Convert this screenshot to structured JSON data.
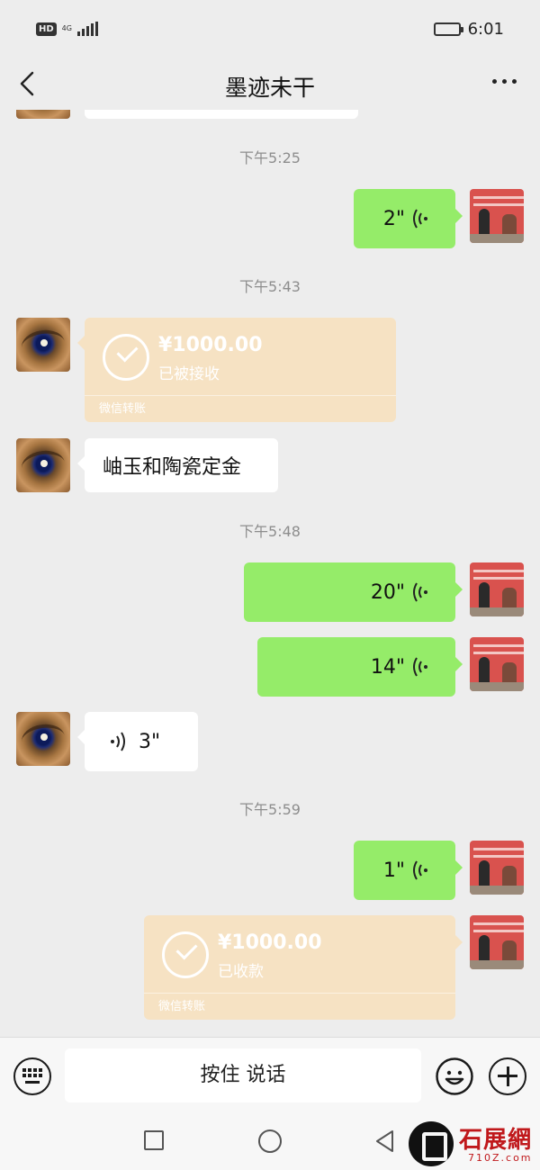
{
  "status_bar": {
    "hd": "HD",
    "network": "4G",
    "time": "6:01"
  },
  "header": {
    "title": "墨迹未干"
  },
  "timestamps": [
    "下午5:25",
    "下午5:43",
    "下午5:48",
    "下午5:59"
  ],
  "messages": {
    "voice_1": {
      "duration": "2\""
    },
    "transfer_1": {
      "amount": "¥1000.00",
      "status": "已被接收",
      "label": "微信转账"
    },
    "text_1": {
      "text": "岫玉和陶瓷定金"
    },
    "voice_2": {
      "duration": "20\""
    },
    "voice_3": {
      "duration": "14\""
    },
    "voice_4": {
      "duration": "3\""
    },
    "voice_5": {
      "duration": "1\""
    },
    "transfer_2": {
      "amount": "¥1000.00",
      "status": "已收款",
      "label": "微信转账"
    }
  },
  "input_bar": {
    "hold_to_talk": "按住 说话"
  },
  "watermark": {
    "name": "石展網",
    "site": "710Z.com"
  },
  "colors": {
    "sent_bubble": "#95ec69",
    "received_bubble": "#ffffff",
    "transfer_bubble": "#f6e2c3",
    "background": "#ededed"
  }
}
